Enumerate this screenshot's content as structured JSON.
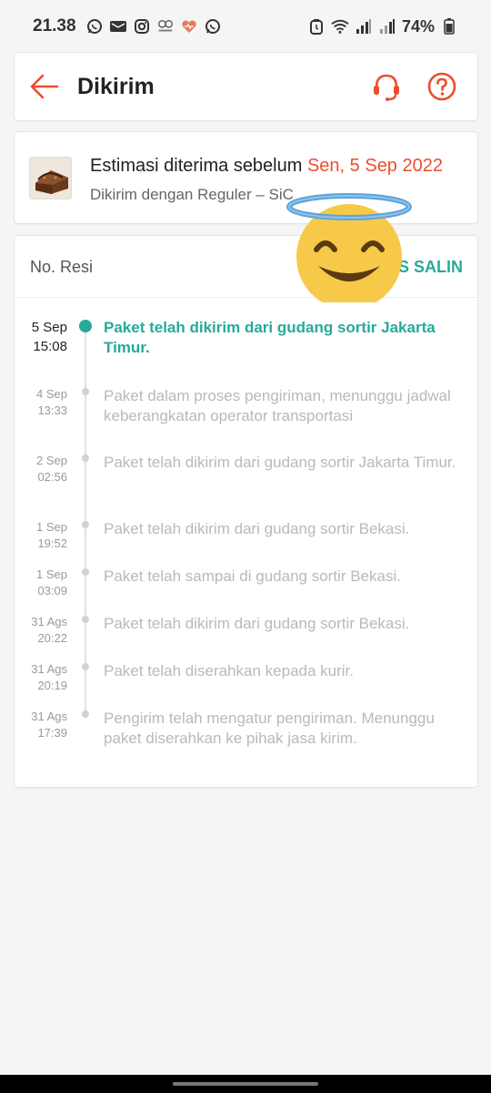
{
  "status_bar": {
    "time": "21.38",
    "notification_icons": [
      "whatsapp-icon",
      "mail-icon",
      "instagram-icon",
      "surplus-icon",
      "health-icon",
      "whatsapp-icon"
    ],
    "battery": "74%"
  },
  "header": {
    "title": "Dikirim",
    "back_icon": "arrow-left-icon",
    "support_icon": "headset-icon",
    "help_icon": "question-icon"
  },
  "estimate": {
    "prefix": "Estimasi diterima sebelum ",
    "date": "Sen, 5 Sep 2022",
    "shipping": "Dikirim dengan Reguler – SiC"
  },
  "tracking": {
    "resi_label": "No. Resi",
    "copy_label": "S SALIN",
    "events": [
      {
        "date": "5 Sep",
        "time": "15:08",
        "text": "Paket telah dikirim dari gudang sortir Jakarta Timur.",
        "active": true
      },
      {
        "date": "4 Sep",
        "time": "13:33",
        "text": "Paket dalam proses pengiriman, menunggu jadwal keberangkatan operator transportasi"
      },
      {
        "date": "2 Sep",
        "time": "02:56",
        "text": "Paket telah dikirim dari gudang sortir Jakarta Timur."
      },
      {
        "date": "1 Sep",
        "time": "19:52",
        "text": "Paket telah dikirim dari gudang sortir Bekasi."
      },
      {
        "date": "1 Sep",
        "time": "03:09",
        "text": "Paket telah sampai di gudang sortir Bekasi."
      },
      {
        "date": "31 Ags",
        "time": "20:22",
        "text": "Paket telah dikirim dari gudang sortir Bekasi."
      },
      {
        "date": "31 Ags",
        "time": "20:19",
        "text": "Paket telah diserahkan kepada kurir."
      },
      {
        "date": "31 Ags",
        "time": "17:39",
        "text": "Pengirim telah mengatur pengiriman. Menunggu paket diserahkan ke pihak jasa kirim."
      }
    ]
  },
  "colors": {
    "accent_orange": "#ee4d2d",
    "accent_teal": "#26aa99"
  }
}
